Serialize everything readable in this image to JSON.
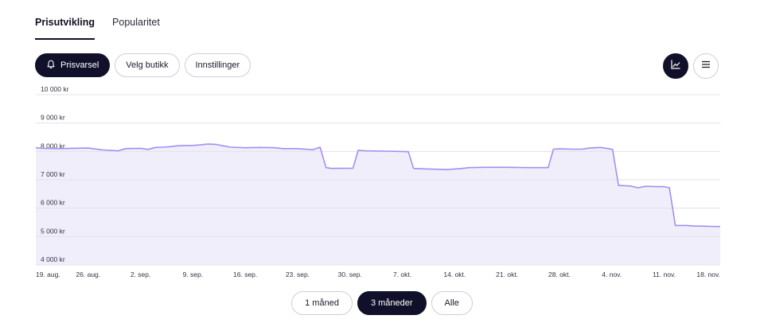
{
  "tabs": [
    {
      "label": "Prisutvikling",
      "active": true
    },
    {
      "label": "Popularitet",
      "active": false
    }
  ],
  "toolbar": {
    "price_alert_label": "Prisvarsel",
    "choose_store_label": "Velg butikk",
    "settings_label": "Innstillinger",
    "chart_view_active": true
  },
  "range_buttons": [
    {
      "label": "1 måned",
      "active": false
    },
    {
      "label": "3 måneder",
      "active": true
    },
    {
      "label": "Alle",
      "active": false
    }
  ],
  "colors": {
    "line": "#a58ef0",
    "fill": "#f1eefc",
    "dark": "#10102a"
  },
  "chart_data": {
    "type": "area",
    "ylim": [
      4000,
      10000
    ],
    "y_ticks": [
      {
        "value": 10000,
        "label": "10 000 kr"
      },
      {
        "value": 9000,
        "label": "9 000 kr"
      },
      {
        "value": 8000,
        "label": "8 000 kr"
      },
      {
        "value": 7000,
        "label": "7 000 kr"
      },
      {
        "value": 6000,
        "label": "6 000 kr"
      },
      {
        "value": 5000,
        "label": "5 000 kr"
      },
      {
        "value": 4000,
        "label": "4 000 kr"
      }
    ],
    "x_ticks": [
      {
        "day": 0,
        "label": "19. aug."
      },
      {
        "day": 7,
        "label": "26. aug."
      },
      {
        "day": 14,
        "label": "2. sep."
      },
      {
        "day": 21,
        "label": "9. sep."
      },
      {
        "day": 28,
        "label": "16. sep."
      },
      {
        "day": 35,
        "label": "23. sep."
      },
      {
        "day": 42,
        "label": "30. sep."
      },
      {
        "day": 49,
        "label": "7. okt."
      },
      {
        "day": 56,
        "label": "14. okt."
      },
      {
        "day": 63,
        "label": "21. okt."
      },
      {
        "day": 70,
        "label": "28. okt."
      },
      {
        "day": 77,
        "label": "4. nov."
      },
      {
        "day": 84,
        "label": "11. nov."
      },
      {
        "day": 91,
        "label": "18. nov."
      }
    ],
    "x_domain": [
      0,
      91.5
    ],
    "points": [
      [
        0,
        8130
      ],
      [
        1,
        8110
      ],
      [
        3,
        8100
      ],
      [
        5,
        8110
      ],
      [
        7,
        8120
      ],
      [
        9,
        8050
      ],
      [
        11,
        8020
      ],
      [
        12,
        8100
      ],
      [
        14,
        8110
      ],
      [
        15,
        8070
      ],
      [
        16,
        8140
      ],
      [
        17,
        8150
      ],
      [
        18,
        8170
      ],
      [
        19,
        8200
      ],
      [
        21,
        8210
      ],
      [
        22,
        8230
      ],
      [
        23,
        8260
      ],
      [
        24,
        8250
      ],
      [
        25,
        8200
      ],
      [
        26,
        8150
      ],
      [
        28,
        8130
      ],
      [
        30,
        8140
      ],
      [
        32,
        8130
      ],
      [
        33,
        8100
      ],
      [
        35,
        8100
      ],
      [
        37,
        8060
      ],
      [
        38,
        8150
      ],
      [
        38.8,
        7430
      ],
      [
        39.5,
        7400
      ],
      [
        42.4,
        7410
      ],
      [
        43.1,
        8040
      ],
      [
        44,
        8020
      ],
      [
        47,
        8010
      ],
      [
        49.8,
        7990
      ],
      [
        50.5,
        7400
      ],
      [
        52.5,
        7380
      ],
      [
        55,
        7360
      ],
      [
        56,
        7380
      ],
      [
        57,
        7400
      ],
      [
        58,
        7430
      ],
      [
        60,
        7440
      ],
      [
        63,
        7440
      ],
      [
        66,
        7430
      ],
      [
        68.5,
        7430
      ],
      [
        69.2,
        8080
      ],
      [
        70,
        8090
      ],
      [
        72,
        8080
      ],
      [
        73,
        8080
      ],
      [
        74,
        8120
      ],
      [
        75.5,
        8140
      ],
      [
        76.5,
        8100
      ],
      [
        77.1,
        8070
      ],
      [
        77.9,
        6800
      ],
      [
        79.5,
        6780
      ],
      [
        80.5,
        6720
      ],
      [
        81.5,
        6770
      ],
      [
        83,
        6760
      ],
      [
        84,
        6760
      ],
      [
        84.7,
        6720
      ],
      [
        85.5,
        5390
      ],
      [
        87,
        5390
      ],
      [
        88,
        5370
      ],
      [
        90,
        5360
      ],
      [
        91.5,
        5350
      ]
    ]
  }
}
